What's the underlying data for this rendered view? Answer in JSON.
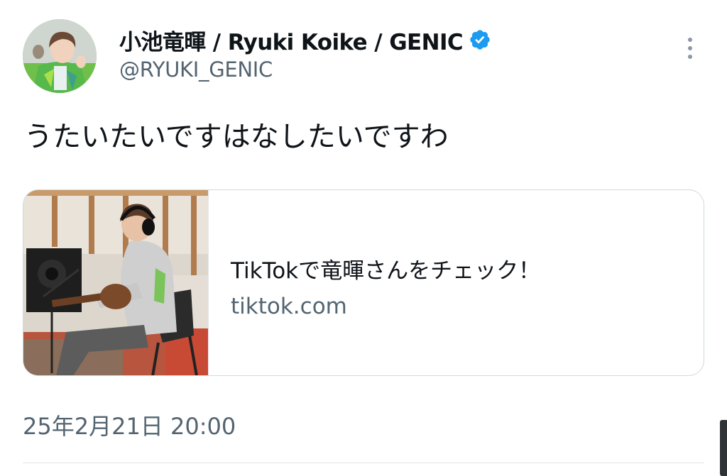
{
  "tweet": {
    "author": {
      "display_name": "小池竜暉 / Ryuki Koike / GENIC",
      "handle": "@RYUKI_GENIC",
      "verified": true
    },
    "text": "うたいたいですはなしたいですわ",
    "card": {
      "title": "TikTokで竜暉さんをチェック！",
      "domain": "tiktok.com"
    },
    "timestamp": "25年2月21日 20:00"
  },
  "colors": {
    "text_primary": "#0f1419",
    "text_secondary": "#536471",
    "verified_blue": "#1d9bf0",
    "border": "#cfd9de"
  },
  "icons": {
    "verified": "verified-badge-icon",
    "more": "more-vertical-icon"
  }
}
